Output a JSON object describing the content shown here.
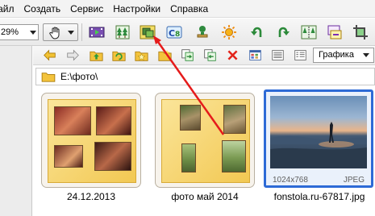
{
  "menu": {
    "items": [
      "Файл",
      "Создать",
      "Сервис",
      "Настройки",
      "Справка"
    ]
  },
  "toolbar": {
    "zoom_value": "29%"
  },
  "toolbar2": {
    "view_mode": "Графика"
  },
  "path": {
    "value": "E:\\фото\\"
  },
  "thumbnails": [
    {
      "caption": "24.12.2013",
      "type": "album"
    },
    {
      "caption": "фото май 2014",
      "type": "album"
    },
    {
      "caption": "fonstola.ru-67817.jpg",
      "type": "image",
      "dimensions": "1024x768",
      "format": "JPEG"
    }
  ],
  "colors": {
    "selection": "#2d6ad6",
    "annotation_arrow": "#e51b1b",
    "album_yellow": "#f2c852"
  }
}
